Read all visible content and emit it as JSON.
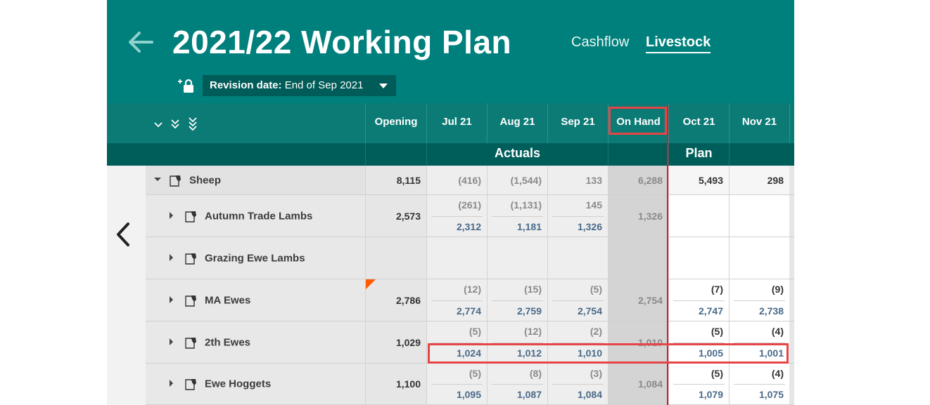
{
  "header": {
    "title": "2021/22 Working Plan",
    "nav": [
      "Cashflow",
      "Livestock"
    ],
    "active_nav": "Livestock",
    "revision_label": "Revision date:",
    "revision_value": "End of Sep 2021"
  },
  "columns": {
    "opening": "Opening",
    "jul": "Jul 21",
    "aug": "Aug 21",
    "sep": "Sep 21",
    "onhand": "On Hand",
    "oct": "Oct 21",
    "nov": "Nov 21"
  },
  "groups": {
    "actuals": "Actuals",
    "plan": "Plan"
  },
  "rows": [
    {
      "name": "Sheep",
      "opening": "8,115",
      "jul": [
        "(416)"
      ],
      "aug": [
        "(1,544)"
      ],
      "sep": [
        "133"
      ],
      "onhand": "6,288",
      "oct": [
        "5,493"
      ],
      "nov": [
        "298"
      ]
    },
    {
      "name": "Autumn Trade Lambs",
      "opening": "2,573",
      "jul": [
        "(261)",
        "2,312"
      ],
      "aug": [
        "(1,131)",
        "1,181"
      ],
      "sep": [
        "145",
        "1,326"
      ],
      "onhand": "1,326",
      "oct": [],
      "nov": []
    },
    {
      "name": "Grazing Ewe Lambs",
      "opening": "",
      "jul": [],
      "aug": [],
      "sep": [],
      "onhand": "",
      "oct": [],
      "nov": []
    },
    {
      "name": "MA Ewes",
      "opening": "2,786",
      "jul": [
        "(12)",
        "2,774"
      ],
      "aug": [
        "(15)",
        "2,759"
      ],
      "sep": [
        "(5)",
        "2,754"
      ],
      "onhand": "2,754",
      "oct": [
        "(7)",
        "2,747"
      ],
      "nov": [
        "(9)",
        "2,738"
      ]
    },
    {
      "name": "2th Ewes",
      "opening": "1,029",
      "jul": [
        "(5)",
        "1,024"
      ],
      "aug": [
        "(12)",
        "1,012"
      ],
      "sep": [
        "(2)",
        "1,010"
      ],
      "onhand": "1,010",
      "oct": [
        "(5)",
        "1,005"
      ],
      "nov": [
        "(4)",
        "1,001"
      ]
    },
    {
      "name": "Ewe Hoggets",
      "opening": "1,100",
      "jul": [
        "(5)",
        "1,095"
      ],
      "aug": [
        "(8)",
        "1,087"
      ],
      "sep": [
        "(3)",
        "1,084"
      ],
      "onhand": "1,084",
      "oct": [
        "(5)",
        "1,079"
      ],
      "nov": [
        "(4)",
        "1,075"
      ]
    }
  ]
}
